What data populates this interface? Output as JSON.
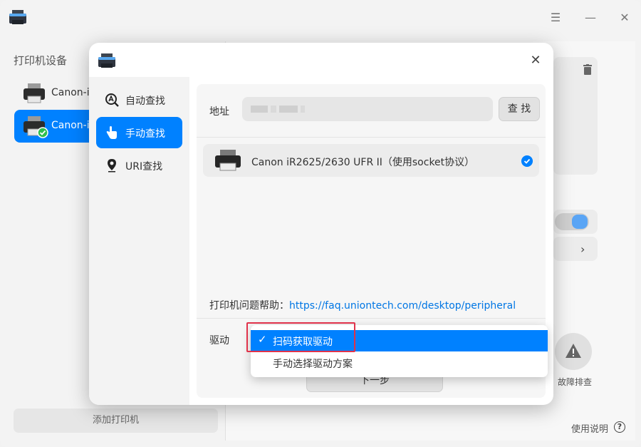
{
  "main": {
    "section_title": "打印机设备",
    "printers": [
      {
        "label": "Canon-iR"
      },
      {
        "label": "Canon-iR"
      }
    ],
    "add_printer_label": "添加打印机",
    "troubleshoot_label": "故障排查",
    "help_label": "使用说明",
    "help_icon_glyph": "?"
  },
  "dialog": {
    "nav": [
      {
        "label": "自动查找",
        "icon": "auto-find-icon"
      },
      {
        "label": "手动查找",
        "icon": "manual-find-icon"
      },
      {
        "label": "URI查找",
        "icon": "uri-find-icon"
      }
    ],
    "address_label": "地址",
    "find_button_label": "查 找",
    "result": {
      "label": "Canon iR2625/2630 UFR II（使用socket协议）"
    },
    "help_prefix": "打印机问题帮助：",
    "help_link": "https://faq.uniontech.com/desktop/peripheral",
    "driver_label": "驱动",
    "next_button_label": "下一步",
    "driver_options": [
      {
        "label": "扫码获取驱动",
        "selected": true
      },
      {
        "label": "手动选择驱动方案",
        "selected": false
      }
    ]
  },
  "colors": {
    "accent": "#0081ff",
    "link": "#0076e4",
    "highlight": "#e0324a"
  }
}
